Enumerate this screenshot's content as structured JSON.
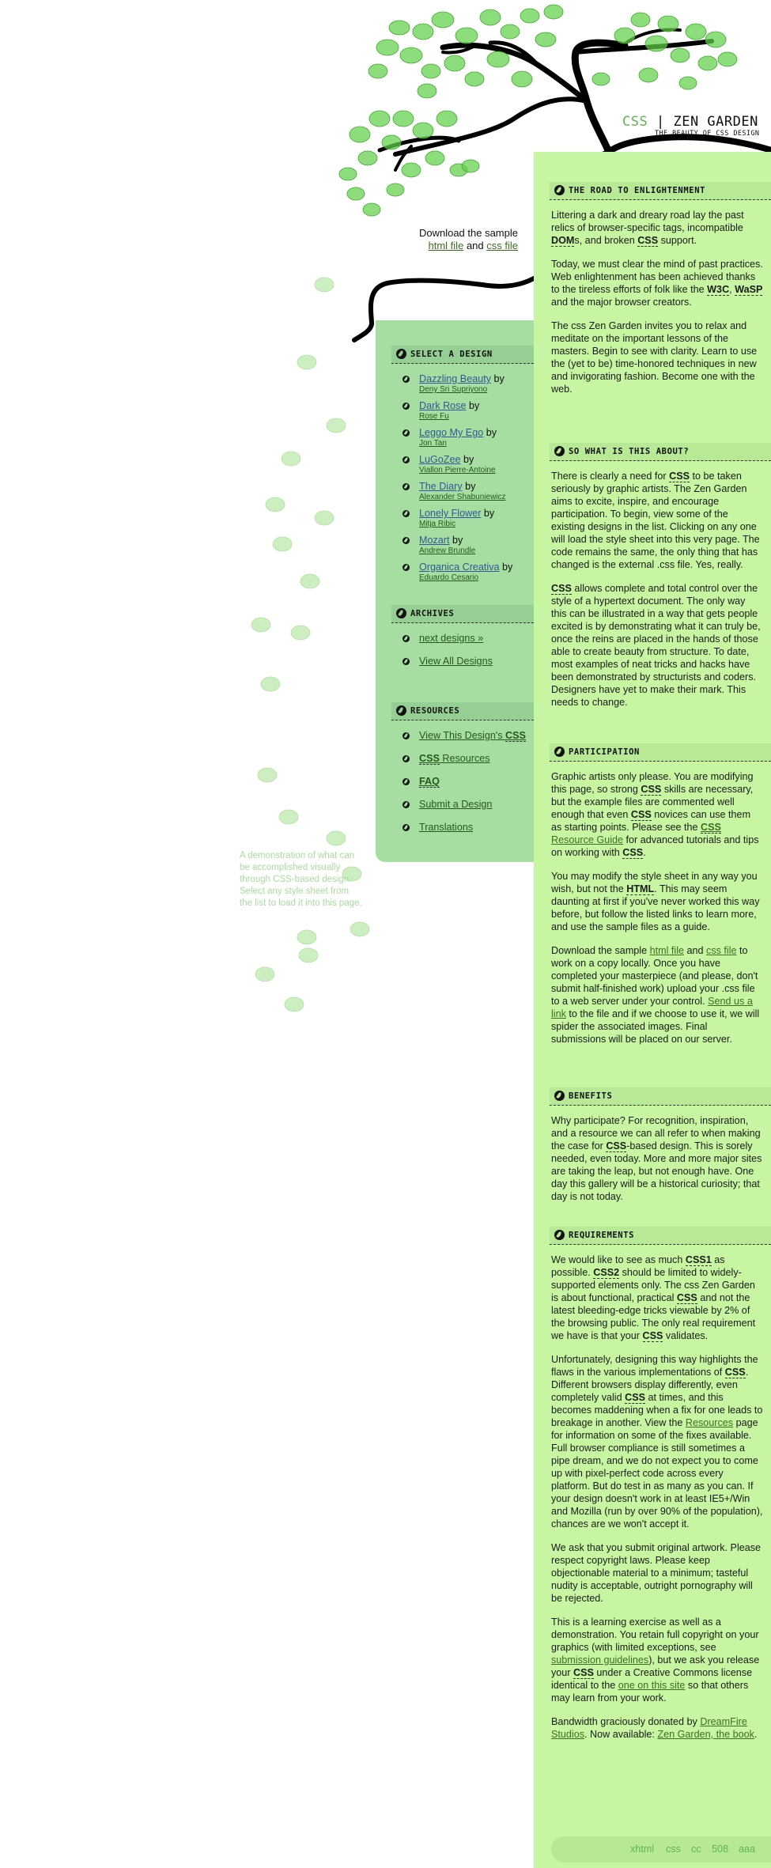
{
  "header": {
    "title_css": "CSS",
    "title_sep": "|",
    "title_rest": "ZEN GARDEN",
    "subtitle": "THE BEAUTY OF CSS DESIGN"
  },
  "download": {
    "line1": "Download the sample",
    "html_file": "html file",
    "and": "and",
    "css_file": "css file"
  },
  "sections": {
    "road": {
      "title": "The Road to Enlightenment",
      "p1": {
        "a": "Littering a dark and dreary road lay the past relics of browser-specific tags, incompatible ",
        "dom": "DOM",
        "b": "s, and broken ",
        "css": "CSS",
        "c": " support."
      },
      "p2": {
        "a": "Today, we must clear the mind of past practices. Web enlightenment has been achieved thanks to the tireless efforts of folk like the ",
        "w3c": "W3C",
        "sep": ", ",
        "wasp": "WaSP",
        "b": " and the major browser creators."
      },
      "p3": "The css Zen Garden invites you to relax and meditate on the important lessons of the masters. Begin to see with clarity. Learn to use the (yet to be) time-honored techniques in new and invigorating fashion. Become one with the web."
    },
    "about": {
      "title": "So What is This About?",
      "p1": {
        "a": "There is clearly a need for ",
        "css": "CSS",
        "b": " to be taken seriously by graphic artists. The Zen Garden aims to excite, inspire, and encourage participation. To begin, view some of the existing designs in the list. Clicking on any one will load the style sheet into this very page. The code remains the same, the only thing that has changed is the external .css file. Yes, really."
      },
      "p2": {
        "css": "CSS",
        "a": " allows complete and total control over the style of a hypertext document. The only way this can be illustrated in a way that gets people excited is by demonstrating what it can truly be, once the reins are placed in the hands of those able to create beauty from structure. To date, most examples of neat tricks and hacks have been demonstrated by structurists and coders. Designers have yet to make their mark. This needs to change."
      }
    },
    "participation": {
      "title": "Participation",
      "p1": {
        "a": "Graphic artists only please. You are modifying this page, so strong ",
        "css1": "CSS",
        "b": " skills are necessary, but the example files are commented well enough that even ",
        "css2": "CSS",
        "c": " novices can use them as starting points. Please see the ",
        "link_css": "CSS",
        "link_rest": " Resource Guide",
        "d": " for advanced tutorials and tips on working with ",
        "css3": "CSS",
        "e": "."
      },
      "p2": {
        "a": "You may modify the style sheet in any way you wish, but not the ",
        "html": "HTML",
        "b": ". This may seem daunting at first if you've never worked this way before, but follow the listed links to learn more, and use the sample files as a guide."
      },
      "p3": {
        "a": "Download the sample ",
        "html_file": "html file",
        "and": " and ",
        "css_file": "css file",
        "b": " to work on a copy locally. Once you have completed your masterpiece (and please, don't submit half-finished work) upload your .css file to a web server under your control. ",
        "send_link": "Send us a link",
        "c": " to the file and if we choose to use it, we will spider the associated images. Final submissions will be placed on our server."
      }
    },
    "benefits": {
      "title": "Benefits",
      "p1": {
        "a": "Why participate? For recognition, inspiration, and a resource we can all refer to when making the case for ",
        "css": "CSS",
        "b": "-based design. This is sorely needed, even today. More and more major sites are taking the leap, but not enough have. One day this gallery will be a historical curiosity; that day is not today."
      }
    },
    "requirements": {
      "title": "Requirements",
      "p1": {
        "a": "We would like to see as much ",
        "css1": "CSS1",
        "b": " as possible. ",
        "css2": "CSS2",
        "c": " should be limited to widely-supported elements only. The css Zen Garden is about functional, practical ",
        "css3": "CSS",
        "d": " and not the latest bleeding-edge tricks viewable by 2% of the browsing public. The only real requirement we have is that your ",
        "css4": "CSS",
        "e": " validates."
      },
      "p2": {
        "a": "Unfortunately, designing this way highlights the flaws in the various implementations of ",
        "css1": "CSS",
        "b": ". Different browsers display differently, even completely valid ",
        "css2": "CSS",
        "c": " at times, and this becomes maddening when a fix for one leads to breakage in another. View the ",
        "resources": "Resources",
        "d": " page for information on some of the fixes available. Full browser compliance is still sometimes a pipe dream, and we do not expect you to come up with pixel-perfect code across every platform. But do test in as many as you can. If your design doesn't work in at least IE5+/Win and Mozilla (run by over 90% of the population), chances are we won't accept it."
      },
      "p3": "We ask that you submit original artwork. Please respect copyright laws. Please keep objectionable material to a minimum; tasteful nudity is acceptable, outright pornography will be rejected.",
      "p4": {
        "a": "This is a learning exercise as well as a demonstration. You retain full copyright on your graphics (with limited exceptions, see ",
        "guidelines": "submission guidelines",
        "b": "), but we ask you release your ",
        "css": "CSS",
        "c": " under a Creative Commons license identical to the ",
        "this_site": "one on this site",
        "d": " so that others may learn from your work."
      },
      "p5": {
        "a": "Bandwidth graciously donated by ",
        "dreamfire": "DreamFire Studios",
        "b": ". Now available: ",
        "book": "Zen Garden, the book",
        "c": "."
      }
    }
  },
  "sidebar": {
    "select_title": "Select a Design",
    "designs": [
      {
        "name": "Dazzling Beauty",
        "by": "by",
        "author": "Deny Sri Supriyono"
      },
      {
        "name": "Dark Rose",
        "by": "by",
        "author": "Rose Fu"
      },
      {
        "name": "Leggo My Ego",
        "by": "by",
        "author": "Jon Tan"
      },
      {
        "name": "LuGoZee",
        "by": "by",
        "author": "Viallon Pierre-Antoine"
      },
      {
        "name": "The Diary",
        "by": "by",
        "author": "Alexander Shabuniewicz"
      },
      {
        "name": "Lonely Flower",
        "by": "by",
        "author": "Mitja Ribic"
      },
      {
        "name": "Mozart",
        "by": "by",
        "author": "Andrew Brundle"
      },
      {
        "name": "Organica Creativa",
        "by": "by",
        "author": "Eduardo Cesario"
      }
    ],
    "archives_title": "Archives",
    "archives": {
      "next": "next designs »",
      "all": "View All Designs"
    },
    "resources_title": "Resources",
    "resources": {
      "view_css_a": "View This Design's ",
      "view_css_b": "CSS",
      "css_res_a": "CSS",
      "css_res_b": " Resources",
      "faq": "FAQ",
      "submit": "Submit a Design",
      "translations": "Translations"
    }
  },
  "extra_text": "A demonstration of what can be accomplished visually through CSS-based design. Select any style sheet from the list to load it into this page.",
  "footer": {
    "links": [
      "xhtml",
      "css",
      "cc",
      "508",
      "aaa"
    ]
  },
  "colors": {
    "main_bg": "#c7f5a2",
    "sidebar_bg": "#a6dea2",
    "leaf": "#6ed34b",
    "link": "#3c6e22"
  }
}
